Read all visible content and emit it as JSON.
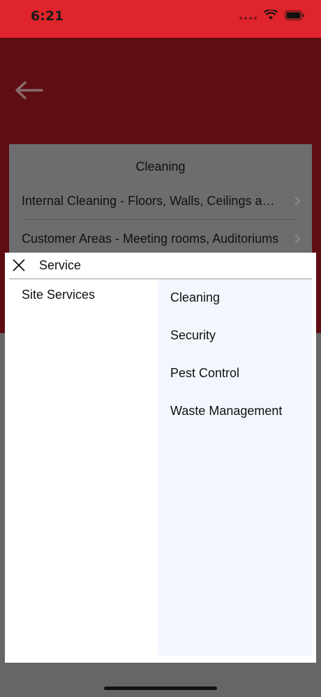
{
  "status_bar": {
    "time": "6:21"
  },
  "background_card": {
    "title": "Cleaning",
    "rows": [
      "Internal Cleaning - Floors, Walls, Ceilings and Windows",
      "Customer Areas - Meeting rooms, Auditoriums"
    ]
  },
  "sheet": {
    "title": "Service",
    "left_items": [
      "Site Services"
    ],
    "right_items": [
      "Cleaning",
      "Security",
      "Pest Control",
      "Waste Management"
    ]
  },
  "colors": {
    "status_bar": "#e0242b",
    "header_dimmed": "#5e0e12",
    "right_panel": "#f3f7fd"
  }
}
